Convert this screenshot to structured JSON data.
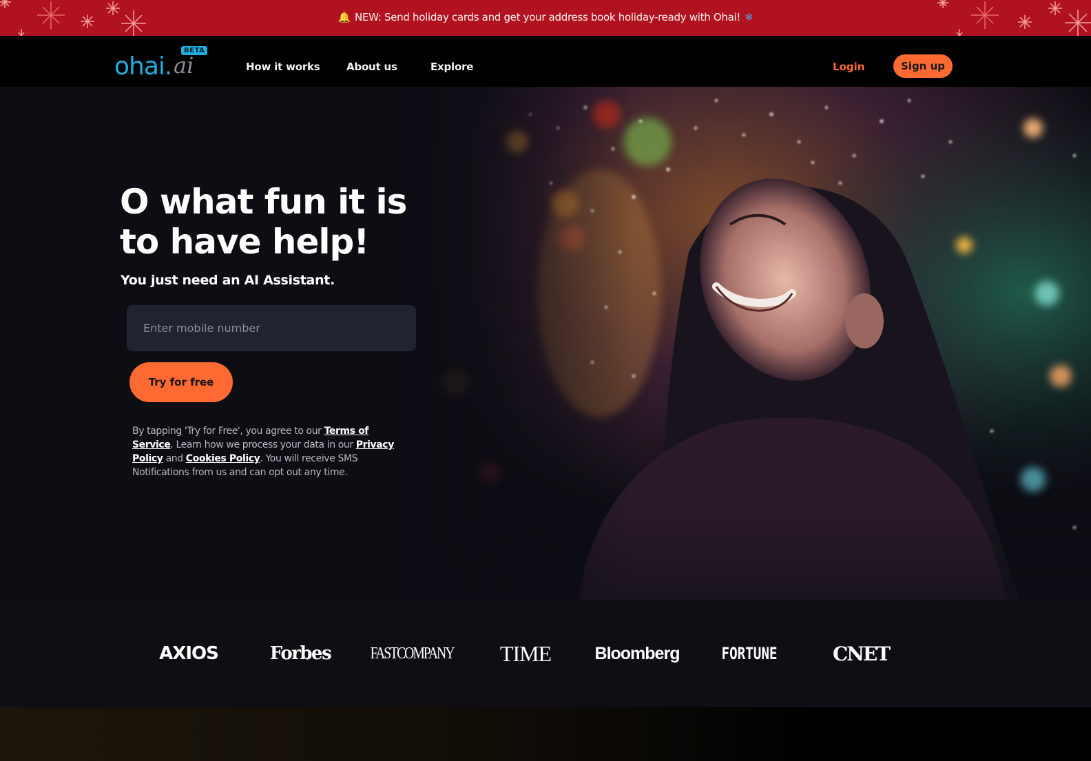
{
  "banner": {
    "bell_icon": "🔔",
    "text": "NEW: Send holiday cards and get your address book holiday-ready with Ohai!",
    "snowflake_icon": "❄",
    "background": "#b1121f"
  },
  "nav": {
    "logo_main": "ohai.",
    "logo_ai": "ai",
    "beta_badge": "BETA",
    "links": [
      {
        "label": "How it works"
      },
      {
        "label": "About us"
      },
      {
        "label": "Explore"
      }
    ],
    "login_label": "Login",
    "signup_label": "Sign up",
    "accent": "#ff6a33",
    "brand": "#1eaee0"
  },
  "hero": {
    "headline": "O what fun it is to have help!",
    "subheadline": "You just need an AI Assistant.",
    "phone_placeholder": "Enter mobile number",
    "phone_value": "",
    "cta_label": "Try for free",
    "legal": {
      "prefix": "By tapping 'Try for Free', you agree to our ",
      "terms_link": "Terms of Service",
      "middle": ". Learn how we process your data in our ",
      "privacy_link": "Privacy Policy",
      "and": " and ",
      "cookies_link": "Cookies Policy",
      "suffix": ". You will receive SMS Notifications from us and can opt out any time."
    },
    "image_alt": "Smiling woman looking up at holiday lights"
  },
  "press": {
    "logos": [
      {
        "name": "AXIOS"
      },
      {
        "name": "Forbes"
      },
      {
        "name": "FASTCOMPANY"
      },
      {
        "name": "TIME"
      },
      {
        "name": "Bloomberg"
      },
      {
        "name": "FORTUNE"
      },
      {
        "name": "CNET"
      }
    ]
  }
}
